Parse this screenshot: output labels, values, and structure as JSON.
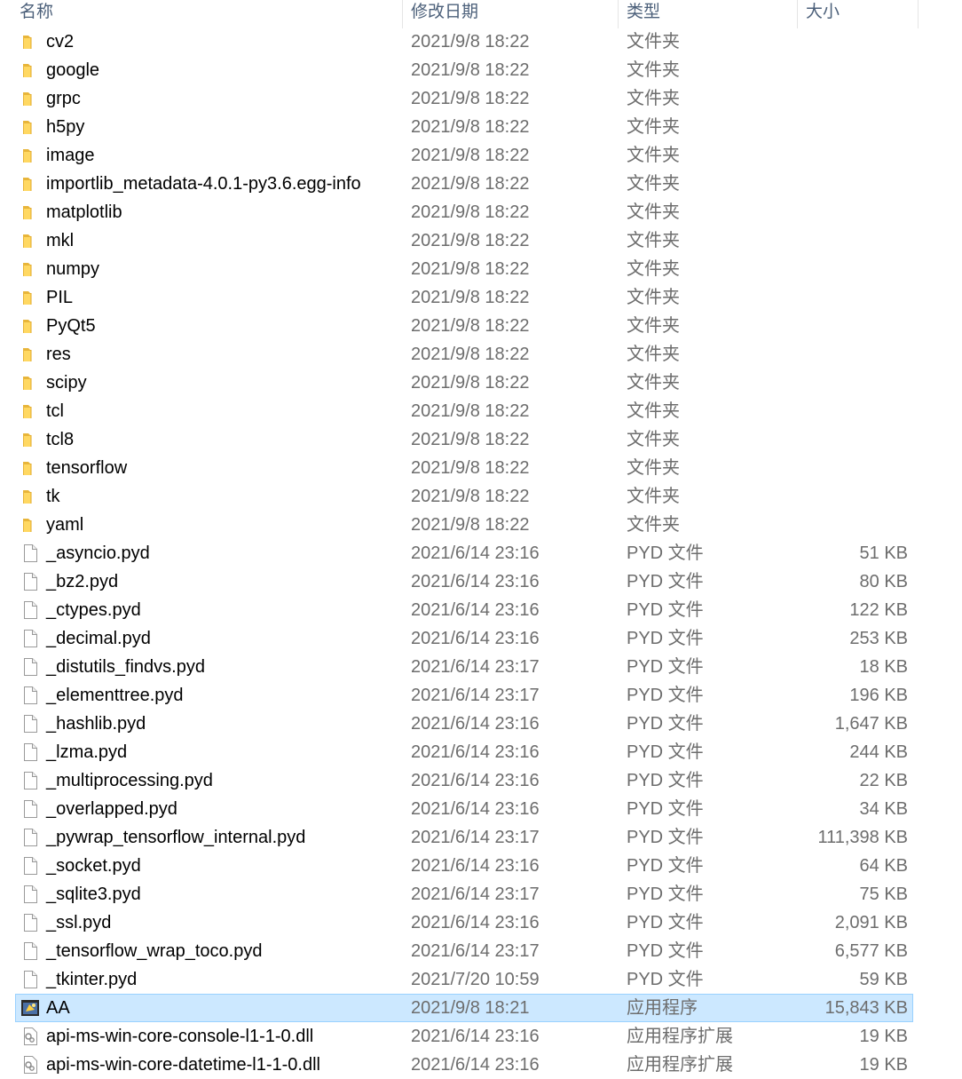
{
  "columns": {
    "name": "名称",
    "date": "修改日期",
    "type": "类型",
    "size": "大小"
  },
  "files": [
    {
      "name": "cv2",
      "date": "2021/9/8 18:22",
      "type": "文件夹",
      "size": "",
      "icon": "folder-icon"
    },
    {
      "name": "google",
      "date": "2021/9/8 18:22",
      "type": "文件夹",
      "size": "",
      "icon": "folder-icon"
    },
    {
      "name": "grpc",
      "date": "2021/9/8 18:22",
      "type": "文件夹",
      "size": "",
      "icon": "folder-icon"
    },
    {
      "name": "h5py",
      "date": "2021/9/8 18:22",
      "type": "文件夹",
      "size": "",
      "icon": "folder-icon"
    },
    {
      "name": "image",
      "date": "2021/9/8 18:22",
      "type": "文件夹",
      "size": "",
      "icon": "folder-icon"
    },
    {
      "name": "importlib_metadata-4.0.1-py3.6.egg-info",
      "date": "2021/9/8 18:22",
      "type": "文件夹",
      "size": "",
      "icon": "folder-icon"
    },
    {
      "name": "matplotlib",
      "date": "2021/9/8 18:22",
      "type": "文件夹",
      "size": "",
      "icon": "folder-icon"
    },
    {
      "name": "mkl",
      "date": "2021/9/8 18:22",
      "type": "文件夹",
      "size": "",
      "icon": "folder-icon"
    },
    {
      "name": "numpy",
      "date": "2021/9/8 18:22",
      "type": "文件夹",
      "size": "",
      "icon": "folder-icon"
    },
    {
      "name": "PIL",
      "date": "2021/9/8 18:22",
      "type": "文件夹",
      "size": "",
      "icon": "folder-icon"
    },
    {
      "name": "PyQt5",
      "date": "2021/9/8 18:22",
      "type": "文件夹",
      "size": "",
      "icon": "folder-icon"
    },
    {
      "name": "res",
      "date": "2021/9/8 18:22",
      "type": "文件夹",
      "size": "",
      "icon": "folder-icon"
    },
    {
      "name": "scipy",
      "date": "2021/9/8 18:22",
      "type": "文件夹",
      "size": "",
      "icon": "folder-icon"
    },
    {
      "name": "tcl",
      "date": "2021/9/8 18:22",
      "type": "文件夹",
      "size": "",
      "icon": "folder-icon"
    },
    {
      "name": "tcl8",
      "date": "2021/9/8 18:22",
      "type": "文件夹",
      "size": "",
      "icon": "folder-icon"
    },
    {
      "name": "tensorflow",
      "date": "2021/9/8 18:22",
      "type": "文件夹",
      "size": "",
      "icon": "folder-icon"
    },
    {
      "name": "tk",
      "date": "2021/9/8 18:22",
      "type": "文件夹",
      "size": "",
      "icon": "folder-icon"
    },
    {
      "name": "yaml",
      "date": "2021/9/8 18:22",
      "type": "文件夹",
      "size": "",
      "icon": "folder-icon"
    },
    {
      "name": "_asyncio.pyd",
      "date": "2021/6/14 23:16",
      "type": "PYD 文件",
      "size": "51 KB",
      "icon": "file-icon"
    },
    {
      "name": "_bz2.pyd",
      "date": "2021/6/14 23:16",
      "type": "PYD 文件",
      "size": "80 KB",
      "icon": "file-icon"
    },
    {
      "name": "_ctypes.pyd",
      "date": "2021/6/14 23:16",
      "type": "PYD 文件",
      "size": "122 KB",
      "icon": "file-icon"
    },
    {
      "name": "_decimal.pyd",
      "date": "2021/6/14 23:16",
      "type": "PYD 文件",
      "size": "253 KB",
      "icon": "file-icon"
    },
    {
      "name": "_distutils_findvs.pyd",
      "date": "2021/6/14 23:17",
      "type": "PYD 文件",
      "size": "18 KB",
      "icon": "file-icon"
    },
    {
      "name": "_elementtree.pyd",
      "date": "2021/6/14 23:17",
      "type": "PYD 文件",
      "size": "196 KB",
      "icon": "file-icon"
    },
    {
      "name": "_hashlib.pyd",
      "date": "2021/6/14 23:16",
      "type": "PYD 文件",
      "size": "1,647 KB",
      "icon": "file-icon"
    },
    {
      "name": "_lzma.pyd",
      "date": "2021/6/14 23:16",
      "type": "PYD 文件",
      "size": "244 KB",
      "icon": "file-icon"
    },
    {
      "name": "_multiprocessing.pyd",
      "date": "2021/6/14 23:16",
      "type": "PYD 文件",
      "size": "22 KB",
      "icon": "file-icon"
    },
    {
      "name": "_overlapped.pyd",
      "date": "2021/6/14 23:16",
      "type": "PYD 文件",
      "size": "34 KB",
      "icon": "file-icon"
    },
    {
      "name": "_pywrap_tensorflow_internal.pyd",
      "date": "2021/6/14 23:17",
      "type": "PYD 文件",
      "size": "111,398 KB",
      "icon": "file-icon"
    },
    {
      "name": "_socket.pyd",
      "date": "2021/6/14 23:16",
      "type": "PYD 文件",
      "size": "64 KB",
      "icon": "file-icon"
    },
    {
      "name": "_sqlite3.pyd",
      "date": "2021/6/14 23:17",
      "type": "PYD 文件",
      "size": "75 KB",
      "icon": "file-icon"
    },
    {
      "name": "_ssl.pyd",
      "date": "2021/6/14 23:16",
      "type": "PYD 文件",
      "size": "2,091 KB",
      "icon": "file-icon"
    },
    {
      "name": "_tensorflow_wrap_toco.pyd",
      "date": "2021/6/14 23:17",
      "type": "PYD 文件",
      "size": "6,577 KB",
      "icon": "file-icon"
    },
    {
      "name": "_tkinter.pyd",
      "date": "2021/7/20 10:59",
      "type": "PYD 文件",
      "size": "59 KB",
      "icon": "file-icon"
    },
    {
      "name": "AA",
      "date": "2021/9/8 18:21",
      "type": "应用程序",
      "size": "15,843 KB",
      "icon": "app-icon",
      "selected": true
    },
    {
      "name": "api-ms-win-core-console-l1-1-0.dll",
      "date": "2021/6/14 23:16",
      "type": "应用程序扩展",
      "size": "19 KB",
      "icon": "dll-icon"
    },
    {
      "name": "api-ms-win-core-datetime-l1-1-0.dll",
      "date": "2021/6/14 23:16",
      "type": "应用程序扩展",
      "size": "19 KB",
      "icon": "dll-icon"
    }
  ]
}
